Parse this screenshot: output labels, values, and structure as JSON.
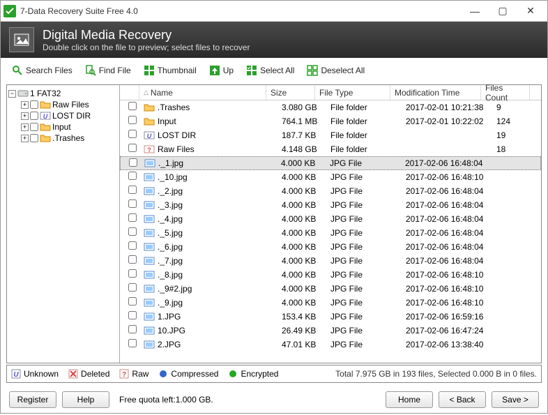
{
  "window": {
    "title": "7-Data Recovery Suite Free 4.0"
  },
  "header": {
    "title": "Digital Media Recovery",
    "subtitle": "Double click on the file to preview; select files to recover"
  },
  "toolbar": {
    "searchFiles": "Search Files",
    "findFile": "Find File",
    "thumbnail": "Thumbnail",
    "up": "Up",
    "selectAll": "Select All",
    "deselectAll": "Deselect All"
  },
  "tree": {
    "root": "1 FAT32",
    "items": [
      {
        "label": "Raw Files",
        "icon": "folder"
      },
      {
        "label": "LOST DIR",
        "icon": "lost"
      },
      {
        "label": "Input",
        "icon": "folder"
      },
      {
        "label": ".Trashes",
        "icon": "folder"
      }
    ]
  },
  "columns": {
    "name": "Name",
    "size": "Size",
    "type": "File Type",
    "mod": "Modification Time",
    "count": "Files Count"
  },
  "files": [
    {
      "name": ".Trashes",
      "size": "3.080 GB",
      "type": "File folder",
      "mod": "2017-02-01 10:21:38",
      "count": "9",
      "icon": "folder"
    },
    {
      "name": "Input",
      "size": "764.1 MB",
      "type": "File folder",
      "mod": "2017-02-01 10:22:02",
      "count": "124",
      "icon": "folder"
    },
    {
      "name": "LOST DIR",
      "size": "187.7 KB",
      "type": "File folder",
      "mod": "",
      "count": "19",
      "icon": "lost"
    },
    {
      "name": "Raw Files",
      "size": "4.148 GB",
      "type": "File folder",
      "mod": "",
      "count": "18",
      "icon": "raw"
    },
    {
      "name": "._1.jpg",
      "size": "4.000 KB",
      "type": "JPG File",
      "mod": "2017-02-06 16:48:04",
      "count": "",
      "icon": "jpg",
      "selected": true
    },
    {
      "name": "._10.jpg",
      "size": "4.000 KB",
      "type": "JPG File",
      "mod": "2017-02-06 16:48:10",
      "count": "",
      "icon": "jpg"
    },
    {
      "name": "._2.jpg",
      "size": "4.000 KB",
      "type": "JPG File",
      "mod": "2017-02-06 16:48:04",
      "count": "",
      "icon": "jpg"
    },
    {
      "name": "._3.jpg",
      "size": "4.000 KB",
      "type": "JPG File",
      "mod": "2017-02-06 16:48:04",
      "count": "",
      "icon": "jpg"
    },
    {
      "name": "._4.jpg",
      "size": "4.000 KB",
      "type": "JPG File",
      "mod": "2017-02-06 16:48:04",
      "count": "",
      "icon": "jpg"
    },
    {
      "name": "._5.jpg",
      "size": "4.000 KB",
      "type": "JPG File",
      "mod": "2017-02-06 16:48:04",
      "count": "",
      "icon": "jpg"
    },
    {
      "name": "._6.jpg",
      "size": "4.000 KB",
      "type": "JPG File",
      "mod": "2017-02-06 16:48:04",
      "count": "",
      "icon": "jpg"
    },
    {
      "name": "._7.jpg",
      "size": "4.000 KB",
      "type": "JPG File",
      "mod": "2017-02-06 16:48:04",
      "count": "",
      "icon": "jpg"
    },
    {
      "name": "._8.jpg",
      "size": "4.000 KB",
      "type": "JPG File",
      "mod": "2017-02-06 16:48:10",
      "count": "",
      "icon": "jpg"
    },
    {
      "name": "._9#2.jpg",
      "size": "4.000 KB",
      "type": "JPG File",
      "mod": "2017-02-06 16:48:10",
      "count": "",
      "icon": "jpg"
    },
    {
      "name": "._9.jpg",
      "size": "4.000 KB",
      "type": "JPG File",
      "mod": "2017-02-06 16:48:10",
      "count": "",
      "icon": "jpg"
    },
    {
      "name": "1.JPG",
      "size": "153.4 KB",
      "type": "JPG File",
      "mod": "2017-02-06 16:59:16",
      "count": "",
      "icon": "jpg"
    },
    {
      "name": "10.JPG",
      "size": "26.49 KB",
      "type": "JPG File",
      "mod": "2017-02-06 16:47:24",
      "count": "",
      "icon": "jpg"
    },
    {
      "name": "2.JPG",
      "size": "47.01 KB",
      "type": "JPG File",
      "mod": "2017-02-06 13:38:40",
      "count": "",
      "icon": "jpg"
    }
  ],
  "legend": {
    "unknown": "Unknown",
    "deleted": "Deleted",
    "raw": "Raw",
    "compressed": "Compressed",
    "encrypted": "Encrypted",
    "summary": "Total 7.975 GB in 193 files, Selected 0.000 B in 0 files."
  },
  "bottom": {
    "register": "Register",
    "help": "Help",
    "quota": "Free quota left:1.000 GB.",
    "home": "Home",
    "back": "< Back",
    "save": "Save >"
  }
}
